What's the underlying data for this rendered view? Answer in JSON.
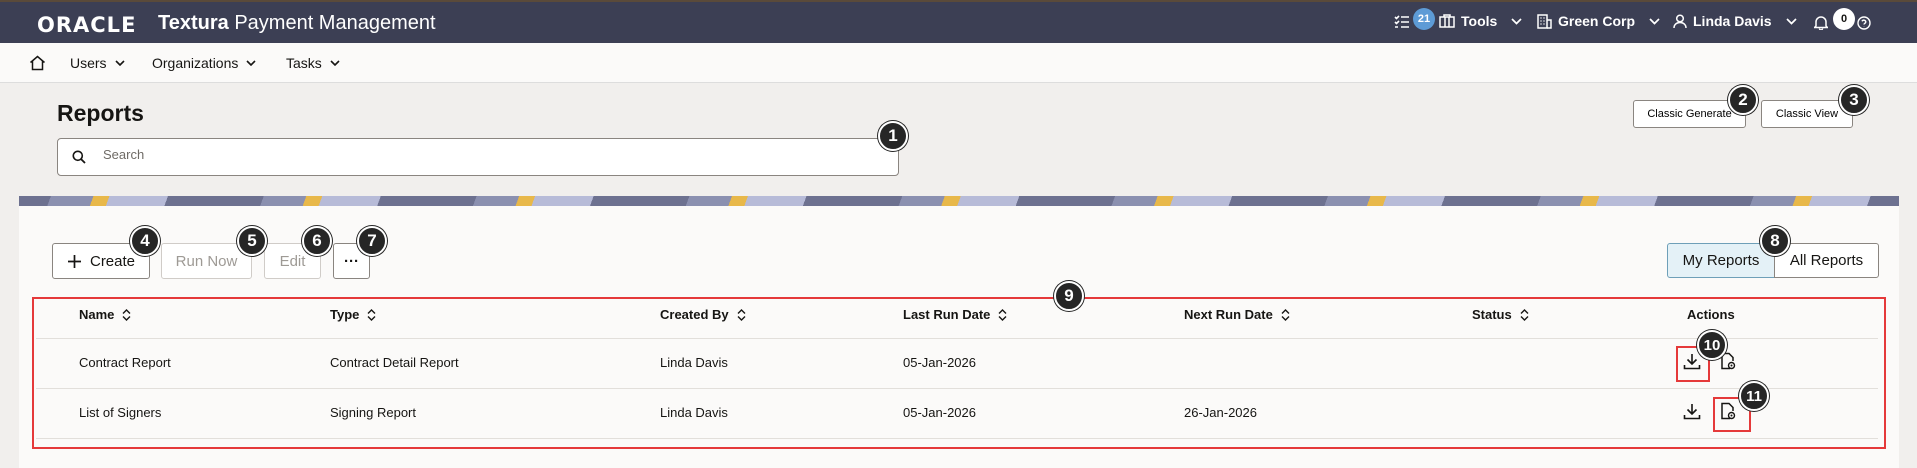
{
  "header": {
    "logo": "ORACLE",
    "app_title_bold": "Textura",
    "app_title_rest": " Payment Management",
    "tasks_count": "21",
    "tools_label": "Tools",
    "org_label": "Green Corp",
    "user_label": "Linda Davis",
    "notifications_count": "0"
  },
  "nav": {
    "items": [
      {
        "label": "Users"
      },
      {
        "label": "Organizations"
      },
      {
        "label": "Tasks"
      }
    ]
  },
  "page": {
    "title": "Reports",
    "search_placeholder": "Search",
    "classic_generate_label": "Classic Generate",
    "classic_view_label": "Classic View"
  },
  "toolbar": {
    "create_label": "Create",
    "run_now_label": "Run Now",
    "edit_label": "Edit",
    "more_label": "···",
    "my_reports_label": "My Reports",
    "all_reports_label": "All Reports"
  },
  "table": {
    "columns": [
      "Name",
      "Type",
      "Created By",
      "Last Run Date",
      "Next Run Date",
      "Status",
      "Actions"
    ],
    "rows": [
      {
        "name": "Contract Report",
        "type": "Contract Detail Report",
        "created_by": "Linda Davis",
        "last_run": "05-Jan-2026",
        "next_run": "",
        "status": ""
      },
      {
        "name": "List of Signers",
        "type": "Signing Report",
        "created_by": "Linda Davis",
        "last_run": "05-Jan-2026",
        "next_run": "26-Jan-2026",
        "status": ""
      }
    ]
  },
  "callouts": [
    "1",
    "2",
    "3",
    "4",
    "5",
    "6",
    "7",
    "8",
    "9",
    "10",
    "11"
  ],
  "colors": {
    "header_bg": "#3c3f54",
    "callout_bg": "#262626",
    "highlight": "#e5393a",
    "badge_blue": "#5d9bd6"
  }
}
